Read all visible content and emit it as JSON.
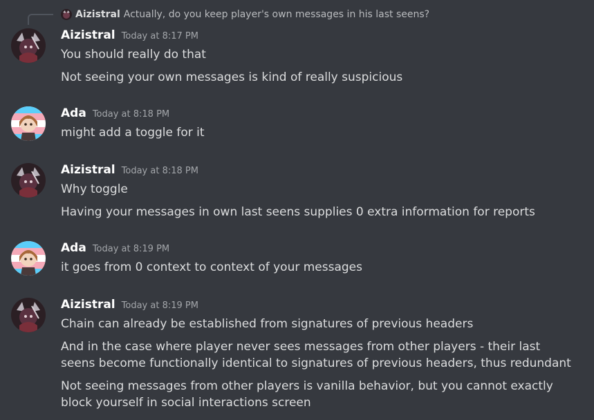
{
  "reply": {
    "author": "Aizistral",
    "text": "Actually, do you keep player's own messages in his last seens?"
  },
  "messages": [
    {
      "author": "Aizistral",
      "time": "Today at 8:17 PM",
      "lines": [
        "You should really do that",
        "Not seeing your own messages is kind of really suspicious"
      ]
    },
    {
      "author": "Ada",
      "time": "Today at 8:18 PM",
      "lines": [
        "might add a toggle for it"
      ]
    },
    {
      "author": "Aizistral",
      "time": "Today at 8:18 PM",
      "lines": [
        "Why toggle",
        "Having your messages in own last seens supplies 0 extra information for reports"
      ]
    },
    {
      "author": "Ada",
      "time": "Today at 8:19 PM",
      "lines": [
        "it goes from 0 context to context of your messages"
      ]
    },
    {
      "author": "Aizistral",
      "time": "Today at 8:19 PM",
      "lines": [
        "Chain can already be established from signatures of previous headers",
        "And in the case where player never sees messages from other players - their last seens become functionally identical to signatures of previous headers, thus redundant",
        "Not seeing messages from other players is vanilla behavior, but you cannot exactly block yourself in social interactions screen"
      ]
    }
  ]
}
